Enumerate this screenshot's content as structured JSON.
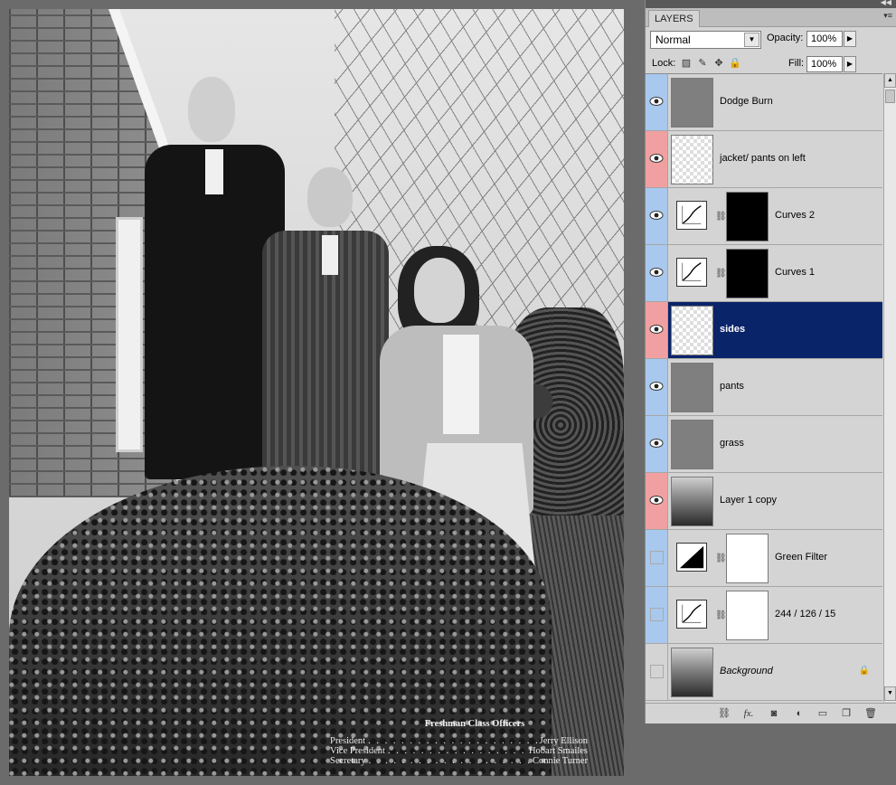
{
  "canvas": {
    "caption": {
      "title": "Freshman Class Officers",
      "rows": [
        {
          "role": "President",
          "name": "Jerry Ellison"
        },
        {
          "role": "Vice President",
          "name": "Hobart Smailes"
        },
        {
          "role": "Secretary",
          "name": "Connie Turner"
        }
      ]
    }
  },
  "panel": {
    "tab_label": "LAYERS",
    "blend_mode": "Normal",
    "opacity_label": "Opacity:",
    "opacity_value": "100%",
    "lock_label": "Lock:",
    "fill_label": "Fill:",
    "fill_value": "100%",
    "layers": [
      {
        "name": "Dodge Burn",
        "visible": true,
        "color": "blue",
        "thumb": "grey"
      },
      {
        "name": "jacket/ pants on left",
        "visible": true,
        "color": "red",
        "thumb": "checker"
      },
      {
        "name": "Curves 2",
        "visible": true,
        "color": "blue",
        "thumb": "adjustment",
        "mask": "dark-mask"
      },
      {
        "name": "Curves 1",
        "visible": true,
        "color": "blue",
        "thumb": "adjustment",
        "mask": "dark-mask"
      },
      {
        "name": "sides",
        "visible": true,
        "color": "red",
        "thumb": "checker",
        "selected": true
      },
      {
        "name": "pants",
        "visible": true,
        "color": "blue",
        "thumb": "grey"
      },
      {
        "name": "grass",
        "visible": true,
        "color": "blue",
        "thumb": "grey"
      },
      {
        "name": "Layer 1 copy",
        "visible": true,
        "color": "red",
        "thumb": "photo"
      },
      {
        "name": "Green Filter",
        "visible": false,
        "color": "blue",
        "thumb": "adjustment",
        "mask": "white"
      },
      {
        "name": "244 / 126 / 15",
        "visible": false,
        "color": "blue",
        "thumb": "adjustment",
        "mask": "white"
      },
      {
        "name": "Background",
        "visible": false,
        "color": "none",
        "thumb": "photo",
        "locked": true
      }
    ],
    "bottom_icons": [
      "link-layers-icon",
      "fx-icon",
      "add-mask-icon",
      "adjustment-layer-icon",
      "new-group-icon",
      "new-layer-icon",
      "trash-icon"
    ]
  }
}
